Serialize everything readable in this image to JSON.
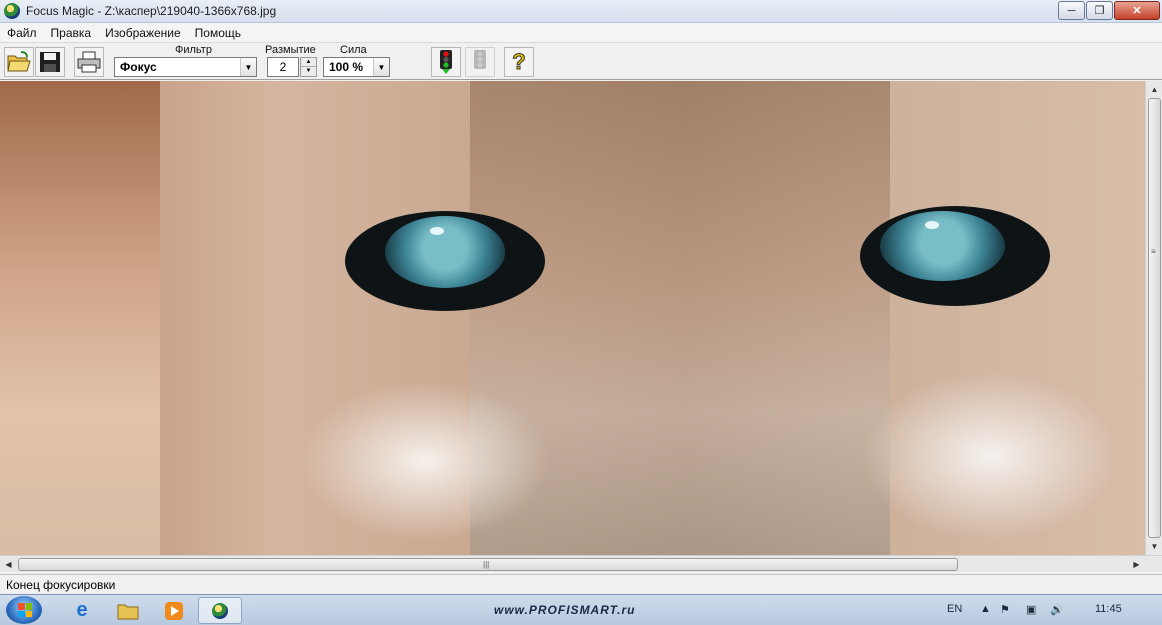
{
  "window": {
    "title": "Focus Magic - Z:\\каспер\\219040-1366x768.jpg",
    "controls": {
      "minimize": "─",
      "maximize": "❐",
      "close": "✕"
    }
  },
  "menu": [
    "Файл",
    "Правка",
    "Изображение",
    "Помощь"
  ],
  "toolbar": {
    "filter_label": "Фильтр",
    "filter_value": "Фокус",
    "blur_label": "Размытие",
    "blur_value": "2",
    "strength_label": "Сила",
    "strength_value": "100 %",
    "help_glyph": "?"
  },
  "status": {
    "text": "Конец фокусировки"
  },
  "taskbar": {
    "watermark": "www.PROFISMART.ru",
    "language": "EN",
    "clock": "11:45"
  },
  "colors": {
    "accent": "#2d6ec0",
    "title_bg": "#dfe6f1"
  }
}
